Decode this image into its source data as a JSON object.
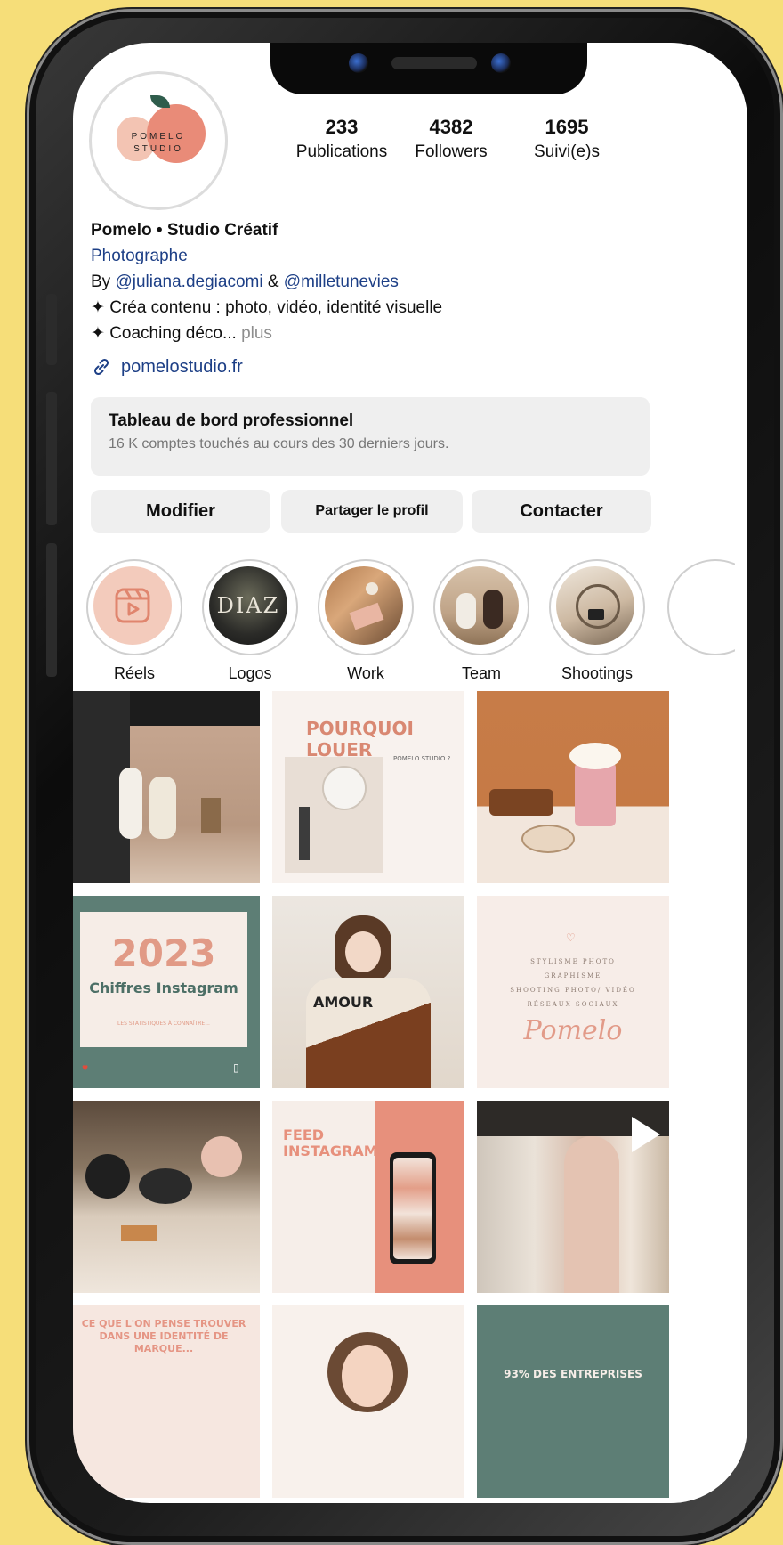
{
  "profile": {
    "avatar_text": "POMELO STUDIO",
    "stats": [
      {
        "num": "233",
        "label": "Publications"
      },
      {
        "num": "4382",
        "label": "Followers"
      },
      {
        "num": "1695",
        "label": "Suivi(e)s"
      }
    ],
    "name": "Pomelo • Studio Créatif",
    "category": "Photographe",
    "by_prefix": "By ",
    "mention1": "@juliana.degiacomi",
    "amp": " & ",
    "mention2": "@milletunevies",
    "bio_line1": "✦ Créa contenu : photo, vidéo, identité visuelle",
    "bio_line2": "✦ Coaching déco...",
    "more": " plus",
    "website": "pomelostudio.fr"
  },
  "dashboard": {
    "title": "Tableau de bord professionnel",
    "subtitle": "16 K comptes touchés au cours des 30 derniers jours."
  },
  "buttons": {
    "edit": "Modifier",
    "share": "Partager le profil",
    "contact": "Contacter"
  },
  "highlights": [
    {
      "label": "Réels"
    },
    {
      "label": "Logos"
    },
    {
      "label": "Work"
    },
    {
      "label": "Team"
    },
    {
      "label": "Shootings"
    }
  ],
  "posts": {
    "p2_title": "POURQUOI LOUER",
    "p2_sub": "POMELO STUDIO ?",
    "p4_year": "2023",
    "p4_title": "Chiffres Instagram",
    "p4_sub": "LES STATISTIQUES À CONNAÎTRE...",
    "p6_l1": "STYLISME PHOTO",
    "p6_l2": "GRAPHISME",
    "p6_l3": "SHOOTING PHOTO/ VIDÉO",
    "p6_l4": "RÉSEAUX SOCIAUX",
    "p6_sign": "Pomelo",
    "p5_text": "AMOUR",
    "p8_title": "FEED INSTAGRAM",
    "p10_text": "CE QUE L'ON PENSE TROUVER DANS UNE IDENTITÉ DE MARQUE...",
    "p12_text": "93% DES ENTREPRISES"
  },
  "colors": {
    "background": "#f6de79",
    "link_blue": "#1d3f86",
    "salmon": "#e98b78",
    "teal": "#5d7e75"
  }
}
